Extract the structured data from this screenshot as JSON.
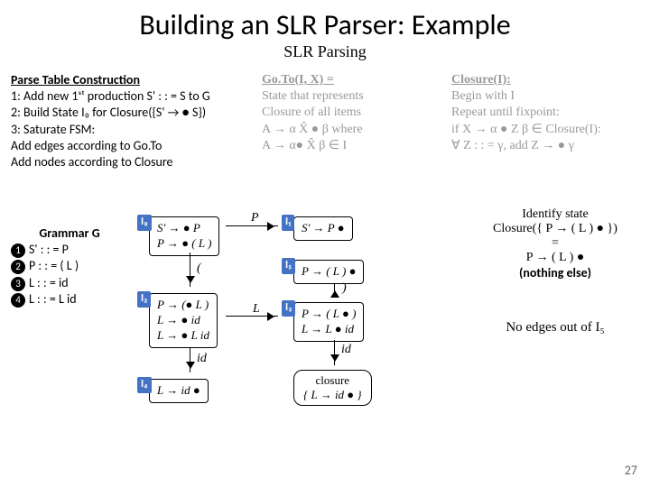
{
  "title": "Building an SLR Parser: Example",
  "subtitle": "SLR Parsing",
  "ptc": {
    "header": "Parse Table Construction",
    "l1": "1: Add new 1ˢᵗ production S' : : = S to G",
    "l2": "2: Build State I₀ for Closure({S' → ● S})",
    "l3": "3: Saturate FSM:",
    "l4": "   Add edges according to Go.To",
    "l5": "   Add nodes according to Closure"
  },
  "goto": {
    "header": "Go.To(I, X) =",
    "l1": "State that represents",
    "l2": "Closure of all items",
    "l3": "A → α X̂ ● β  where",
    "l4": "A → α● X̂ β ∈ I"
  },
  "closure": {
    "header": "Closure(I):",
    "l1": "Begin with I",
    "l2": "Repeat until fixpoint:",
    "l3": "if X → α ● Z β ∈ Closure(I):",
    "l4": "∀ Z : : = γ,  add   Z → ● γ"
  },
  "grammar": {
    "header": "Grammar G",
    "r1": "S' : : = P",
    "r2": "P  : : = ( L )",
    "r3": "L  : : = id",
    "r4": "L  : : = L id"
  },
  "states": {
    "I0": {
      "label": "I₀",
      "items": [
        "S' → ● P",
        "P → ● ( L )"
      ]
    },
    "I1": {
      "label": "I₁",
      "items": [
        "S' → P ●"
      ]
    },
    "I2": {
      "label": "I₂",
      "items": [
        "P → (● L )",
        "L → ● id",
        "L → ● L id"
      ]
    },
    "I3": {
      "label": "I₃",
      "items": [
        "P → ( L ● )",
        "L → L ● id"
      ]
    },
    "I4": {
      "label": "I₄",
      "items": [
        "L → id ●"
      ]
    },
    "I5": {
      "label": "I₅",
      "items": [
        "P → ( L ) ●"
      ]
    }
  },
  "edges": {
    "P": "P",
    "lparen": "(",
    "L": "L",
    "id1": "id",
    "id2": "id",
    "rparen": ")"
  },
  "ident": {
    "l1": "Identify state",
    "l2": "Closure({ P → ( L ) ● })",
    "l3": "=",
    "l4": "P → ( L ) ●",
    "l5": "(nothing else)"
  },
  "noedges": "No edges out of I₅",
  "closurebox": {
    "l1": "closure",
    "l2": "{ L → id ● }"
  },
  "pagenum": "27"
}
